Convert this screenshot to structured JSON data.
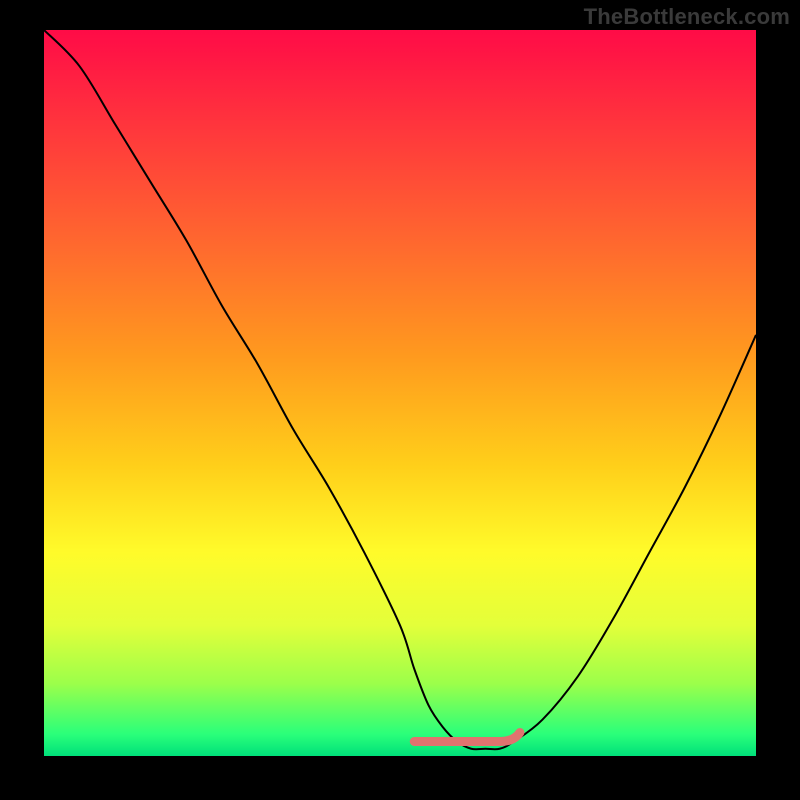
{
  "watermark": "TheBottleneck.com",
  "chart_data": {
    "type": "line",
    "title": "",
    "xlabel": "",
    "ylabel": "",
    "xlim": [
      0,
      100
    ],
    "ylim": [
      0,
      100
    ],
    "grid": false,
    "legend": false,
    "series": [
      {
        "name": "bottleneck-curve",
        "x": [
          0,
          5,
          10,
          15,
          20,
          25,
          30,
          35,
          40,
          45,
          50,
          52,
          54,
          56,
          58,
          60,
          62,
          64,
          66,
          70,
          75,
          80,
          85,
          90,
          95,
          100
        ],
        "y": [
          100,
          95,
          87,
          79,
          71,
          62,
          54,
          45,
          37,
          28,
          18,
          12,
          7,
          4,
          2,
          1,
          1,
          1,
          2,
          5,
          11,
          19,
          28,
          37,
          47,
          58
        ]
      },
      {
        "name": "optimal-band",
        "note": "red flat segment near minimum",
        "x": [
          52,
          66
        ],
        "y": [
          2,
          2
        ]
      }
    ],
    "gradient_stops": [
      {
        "offset": 0.0,
        "color": "#ff0b47"
      },
      {
        "offset": 0.15,
        "color": "#ff3b3b"
      },
      {
        "offset": 0.3,
        "color": "#ff6a2e"
      },
      {
        "offset": 0.45,
        "color": "#ff9a1e"
      },
      {
        "offset": 0.6,
        "color": "#ffcf1a"
      },
      {
        "offset": 0.72,
        "color": "#fffb2a"
      },
      {
        "offset": 0.82,
        "color": "#e3ff3a"
      },
      {
        "offset": 0.9,
        "color": "#9cff4a"
      },
      {
        "offset": 0.97,
        "color": "#2aff7a"
      },
      {
        "offset": 1.0,
        "color": "#00e07a"
      }
    ],
    "inner_width": 712,
    "inner_height": 726
  }
}
